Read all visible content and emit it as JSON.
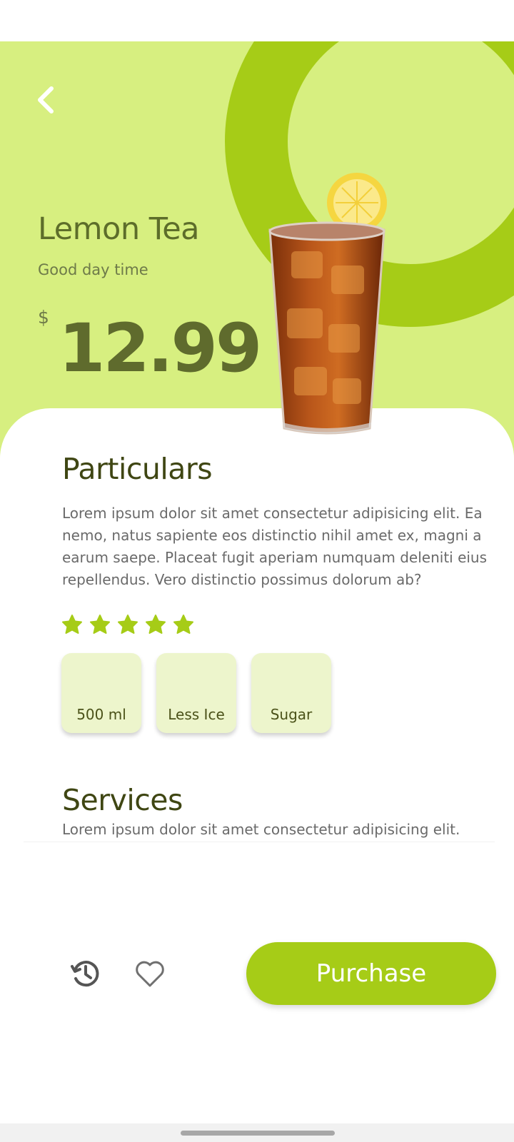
{
  "colors": {
    "accent": "#a6cc17",
    "hero_background": "#d7ef80",
    "title_text": "#3f4613",
    "body_text": "#6a6a6a",
    "chip_background": "#edf5cc"
  },
  "header": {
    "back_icon": "chevron-left-icon"
  },
  "product": {
    "name": "Lemon Tea",
    "tagline": "Good day time",
    "currency": "$",
    "price": "12.99",
    "image": "iced-lemon-tea-glass"
  },
  "particulars": {
    "title": "Particulars",
    "description": " Lorem ipsum dolor sit amet consectetur adipisicing elit. Ea nemo, natus sapiente eos distinctio nihil amet ex, magni a earum saepe. Placeat fugit aperiam numquam deleniti eius repellendus. Vero distinctio possimus dolorum ab?",
    "rating": 5,
    "rating_max": 5,
    "star_icon": "star-icon"
  },
  "options": [
    {
      "label": "500 ml"
    },
    {
      "label": "Less Ice"
    },
    {
      "label": "Sugar"
    }
  ],
  "services": {
    "title": "Services",
    "description": " Lorem ipsum dolor sit amet consectetur adipisicing elit."
  },
  "footer": {
    "history_icon": "history-icon",
    "favorite_icon": "heart-icon",
    "purchase_label": "Purchase"
  }
}
